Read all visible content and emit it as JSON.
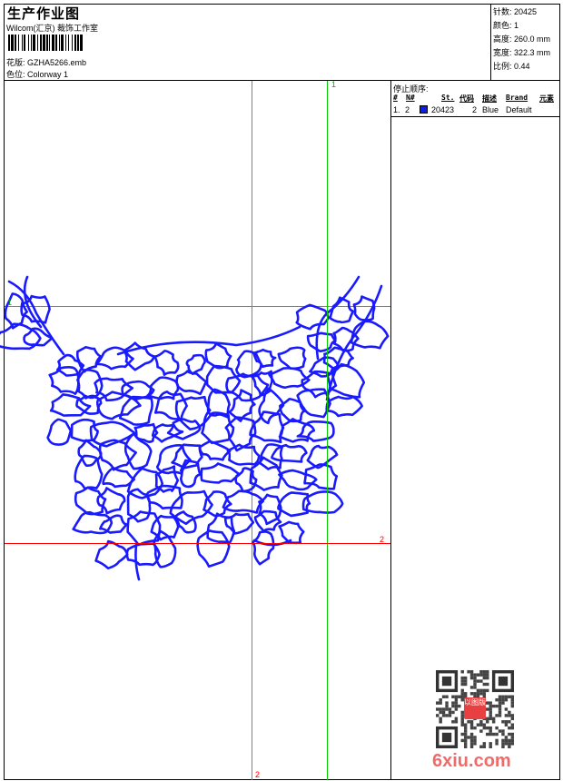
{
  "header": {
    "title": "生产作业图",
    "studio": "Wilcom(汇京) 裁饰工作室",
    "design_label": "花版:",
    "design_value": "GZHA5266.emb",
    "colorway_label": "色位:",
    "colorway_value": "Colorway 1"
  },
  "stats": {
    "stitches_label": "针数:",
    "stitches": "20425",
    "colors_label": "颜色:",
    "colors": "1",
    "height_label": "高度:",
    "height": "260.0 mm",
    "width_label": "宽度:",
    "width": "322.3 mm",
    "scale_label": "比例:",
    "scale": "0.44"
  },
  "stop_sequence": {
    "title": "停止顺序:",
    "columns": [
      "#",
      "N#",
      "St.",
      "代码",
      "描述",
      "Brand",
      "元素"
    ],
    "rows": [
      {
        "index": "1.",
        "needle": "2",
        "color": "#0a1ef0",
        "stitches": "20423",
        "code": "2",
        "description": "Blue",
        "brand": "Default"
      }
    ]
  },
  "guides": {
    "v1": "1",
    "h1": "1",
    "h2": "2",
    "v2": "2"
  },
  "colors": {
    "thread": "#1a1aff",
    "guide_green": "#00cc00",
    "guide_red": "#ff0000",
    "guide_gray": "#808080"
  },
  "watermark": {
    "text": "6xiu.com",
    "stamp": "以图版"
  }
}
